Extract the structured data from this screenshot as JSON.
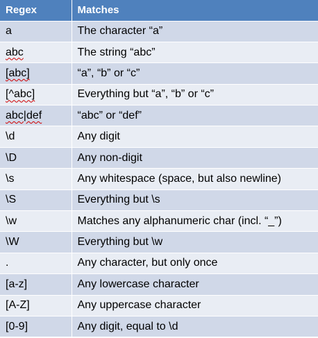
{
  "table": {
    "headers": [
      "Regex",
      "Matches"
    ],
    "rows": [
      {
        "regex": "a",
        "matches": "The character “a”",
        "spell_flag": false
      },
      {
        "regex": "abc",
        "matches": "The string “abc”",
        "spell_flag": true
      },
      {
        "regex": "[abc]",
        "matches": "“a”, “b” or “c”",
        "spell_flag": true
      },
      {
        "regex": "[^abc]",
        "matches": "Everything but “a”, “b” or “c”",
        "spell_flag": true
      },
      {
        "regex": "abc|def",
        "matches": "“abc” or “def”",
        "spell_flag": true
      },
      {
        "regex": "\\d",
        "matches": "Any digit",
        "spell_flag": false
      },
      {
        "regex": "\\D",
        "matches": "Any non-digit",
        "spell_flag": false
      },
      {
        "regex": "\\s",
        "matches": "Any whitespace (space, but also newline)",
        "spell_flag": false
      },
      {
        "regex": "\\S",
        "matches": "Everything but \\s",
        "spell_flag": false
      },
      {
        "regex": "\\w",
        "matches": "Matches any alphanumeric char (incl. “_”)",
        "spell_flag": false
      },
      {
        "regex": "\\W",
        "matches": "Everything but \\w",
        "spell_flag": false
      },
      {
        "regex": ".",
        "matches": "Any character, but only once",
        "spell_flag": false
      },
      {
        "regex": "[a-z]",
        "matches": "Any lowercase character",
        "spell_flag": false
      },
      {
        "regex": "[A-Z]",
        "matches": "Any uppercase character",
        "spell_flag": false
      },
      {
        "regex": "[0-9]",
        "matches": "Any digit, equal to \\d",
        "spell_flag": false
      }
    ]
  },
  "colors": {
    "header_bg": "#4f81bd",
    "row_odd_bg": "#d0d8e8",
    "row_even_bg": "#e9edf4",
    "header_text": "#ffffff"
  }
}
